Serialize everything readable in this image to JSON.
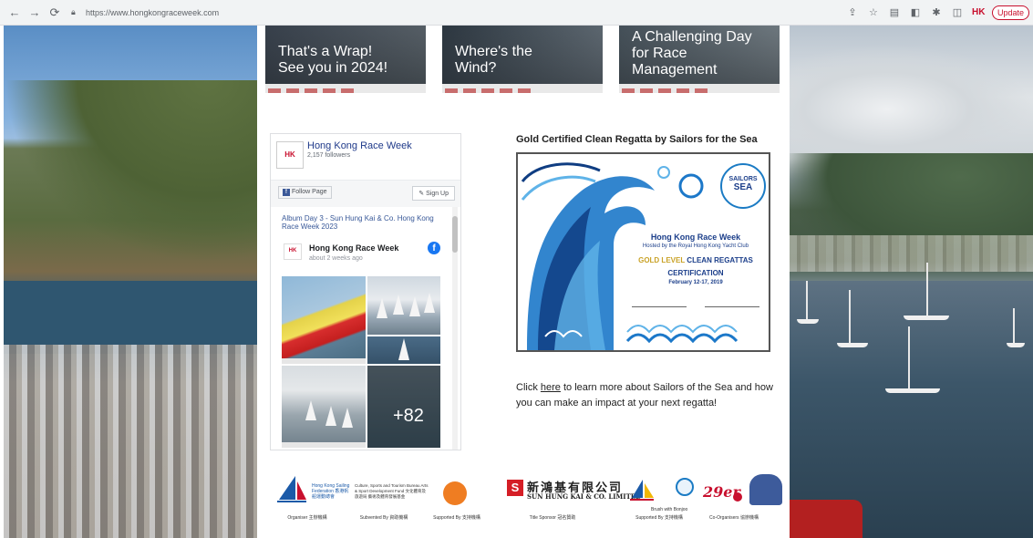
{
  "browser": {
    "url": "https://www.hongkongraceweek.com",
    "update_label": "Update",
    "hk_badge": "HK"
  },
  "news": [
    {
      "title_line1": "That's a Wrap!",
      "title_line2": "See you in 2024!",
      "title_line3": ""
    },
    {
      "title_line1": "Where's the",
      "title_line2": "Wind?",
      "title_line3": ""
    },
    {
      "title_line1": "A Challenging Day",
      "title_line2": "for Race",
      "title_line3": "Management"
    }
  ],
  "facebook": {
    "page_name": "Hong Kong Race Week",
    "followers": "2,157 followers",
    "avatar_text": "HK",
    "follow_label": "Follow Page",
    "signup_label": "Sign Up",
    "album_title": "Album Day 3 - Sun Hung Kai & Co. Hong Kong Race Week 2023",
    "post_author": "Hong Kong Race Week",
    "post_time": "about 2 weeks ago",
    "more_photos": "+82"
  },
  "certificate": {
    "heading": "Gold Certified Clean Regatta by Sailors for the Sea",
    "title": "Hong Kong Race Week",
    "hosted": "Hosted by the Royal Hong Kong Yacht Club",
    "gold": "GOLD LEVEL",
    "clean": "CLEAN REGATTAS",
    "certification": "CERTIFICATION",
    "dates": "February 12-17, 2019",
    "badge_line1": "SAILORS",
    "badge_line2": "SEA"
  },
  "cert_text": {
    "before": "Click ",
    "link": "here",
    "after": " to learn more about Sailors of the Sea and how you can make an impact at your next regatta!"
  },
  "sponsors": {
    "hksf_name": "Hong Kong Sailing Federation 香港帆船運動總會",
    "csb_text": "Culture, Sports and Tourism Bureau Arts & Sport Development Fund 文化體育及旅遊局 藝術及體育發展基金",
    "organiser": "Organiser 主辦機構",
    "subvented": "Subvented By 資助機構",
    "supported": "Supported By 支持機構",
    "title_sponsor": "Title Sponsor 冠名贊助",
    "supported2": "Supported By 支持機構",
    "co_organisers": "Co-Organisers 協辦機構",
    "shk_cn": "新鴻基有限公司",
    "shk_en": "SUN HUNG KAI & CO. LIMITED",
    "shk_letter": "S",
    "brush_text": "Brush with Bonjoo",
    "logo_29er": "29er"
  }
}
